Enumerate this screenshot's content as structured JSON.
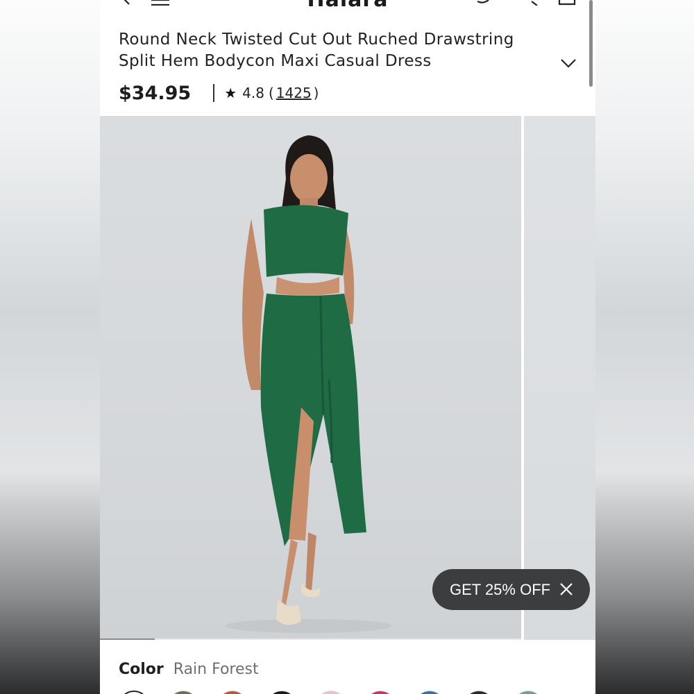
{
  "header": {
    "brand": "Halara"
  },
  "product": {
    "title_line1": "Round Neck Twisted Cut Out Ruched Drawstring",
    "title_line2": "Split Hem Bodycon Maxi Casual Dress",
    "price": "$34.95",
    "rating": "4.8",
    "review_count": "1425",
    "open_paren": "(",
    "close_paren": ")"
  },
  "gallery": {
    "progress": 0.13
  },
  "promo": {
    "label": "GET 25% OFF"
  },
  "color": {
    "label": "Color",
    "selected": "Rain Forest",
    "swatches": [
      "#ffffff",
      "#6b6f5a",
      "#b5563f",
      "#1a1a1a",
      "#e9c2d0",
      "#c2366e",
      "#3f6f9c",
      "#2a2a2a",
      "#7a9a92"
    ]
  },
  "colors": {
    "dress_green": "#1f6b43",
    "promo_bg": "#3c3d3e"
  }
}
